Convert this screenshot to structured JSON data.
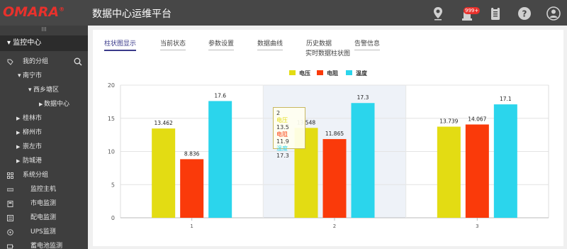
{
  "header": {
    "logo": "OMARA",
    "logo_mark": "®",
    "title": "数据中心运维平台",
    "badge": "999+",
    "icons": [
      "location-pin-icon",
      "alarm-light-icon",
      "clipboard-icon",
      "help-icon",
      "user-avatar-icon"
    ]
  },
  "sidebar": {
    "grip": "III",
    "section": "监控中心",
    "my_group": "我的分组",
    "tree": {
      "city": "南宁市",
      "district": "西乡塘区",
      "node": "数据中心",
      "others": [
        "桂林市",
        "柳州市",
        "崇左市",
        "防城港"
      ]
    },
    "system_group": "系统分组",
    "items": [
      "监控主机",
      "市电监测",
      "配电监测",
      "UPS监测",
      "蓄电池监测"
    ]
  },
  "tabs": [
    {
      "label": "柱状图显示",
      "active": true
    },
    {
      "label": "当前状态",
      "active": false
    },
    {
      "label": "参数设置",
      "active": false
    },
    {
      "label": "数据曲线",
      "active": false
    },
    {
      "label": "历史数据",
      "active": false
    },
    {
      "label": "告警信息",
      "active": false
    }
  ],
  "subtitle": "实时数据柱状图",
  "colors": {
    "voltage": "#e3dc13",
    "resistance": "#fa3a0a",
    "temperature": "#2bd5ec",
    "accent": "#3a3a8a"
  },
  "chart_data": {
    "type": "bar",
    "categories": [
      "1",
      "2",
      "3"
    ],
    "ylim": [
      0,
      20
    ],
    "yticks": [
      0,
      5,
      10,
      15,
      20
    ],
    "series": [
      {
        "name": "电压",
        "values": [
          13.462,
          13.548,
          13.739
        ],
        "labels": [
          "13.462",
          "13.548",
          "13.739"
        ]
      },
      {
        "name": "电阻",
        "values": [
          8.836,
          11.865,
          14.067
        ],
        "labels": [
          "8.836",
          "11.865",
          "14.067"
        ]
      },
      {
        "name": "温度",
        "values": [
          17.6,
          17.3,
          17.1
        ],
        "labels": [
          "17.6",
          "17.3",
          "17.1"
        ]
      }
    ],
    "highlight_category": "2",
    "tooltip": {
      "title": "2",
      "rows": [
        {
          "name": "电压",
          "value": "13.5"
        },
        {
          "name": "电阻",
          "value": "11.9"
        },
        {
          "name": "温度",
          "value": "17.3"
        }
      ]
    }
  }
}
